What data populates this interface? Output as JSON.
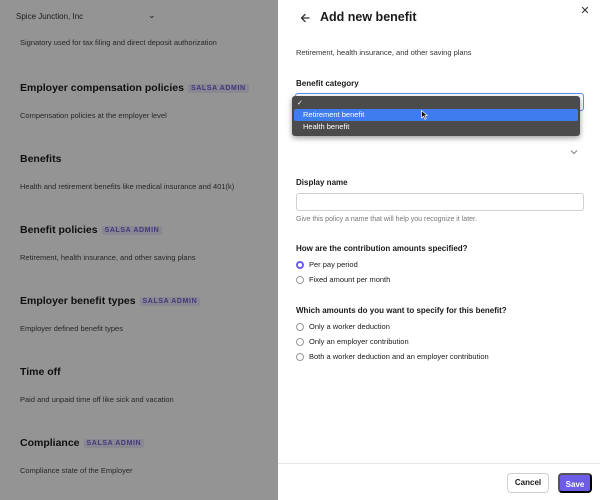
{
  "background": {
    "company_name": "Spice Junction, Inc",
    "first_description": "Signatory used for tax filing and direct deposit authorization",
    "admin_badge": "SALSA ADMIN",
    "sections": [
      {
        "title": "Employer compensation policies",
        "admin": true,
        "description": "Compensation policies at the employer level"
      },
      {
        "title": "Benefits",
        "admin": false,
        "description": "Health and retirement benefits like medical insurance and 401(k)"
      },
      {
        "title": "Benefit policies",
        "admin": true,
        "description": "Retirement, health insurance, and other saving plans"
      },
      {
        "title": "Employer benefit types",
        "admin": true,
        "description": "Employer defined benefit types"
      },
      {
        "title": "Time off",
        "admin": false,
        "description": "Paid and unpaid time off like sick and vacation"
      },
      {
        "title": "Compliance",
        "admin": true,
        "description": "Compliance state of the Employer"
      }
    ]
  },
  "drawer": {
    "title": "Add new benefit",
    "subtitle": "Retirement, health insurance, and other saving plans",
    "benefit_category": {
      "label": "Benefit category",
      "options": [
        {
          "label": "",
          "checked": true
        },
        {
          "label": "Retirement benefit",
          "highlighted": true
        },
        {
          "label": "Health benefit"
        }
      ]
    },
    "display_name": {
      "label": "Display name",
      "value": "",
      "help": "Give this policy a name that will help you recognize it later."
    },
    "contribution": {
      "label": "How are the contribution amounts specified?",
      "options": [
        {
          "label": "Per pay period",
          "checked": true
        },
        {
          "label": "Fixed amount per month",
          "checked": false
        }
      ]
    },
    "amounts": {
      "label": "Which amounts do you want to specify for this benefit?",
      "options": [
        {
          "label": "Only a worker deduction",
          "checked": false
        },
        {
          "label": "Only an employer contribution",
          "checked": false
        },
        {
          "label": "Both a worker deduction and an employer contribution",
          "checked": false
        }
      ]
    },
    "footer": {
      "cancel_label": "Cancel",
      "save_label": "Save"
    }
  },
  "colors": {
    "accent": "#6c5ce7",
    "dropdown_highlight": "#3e7cf0"
  }
}
